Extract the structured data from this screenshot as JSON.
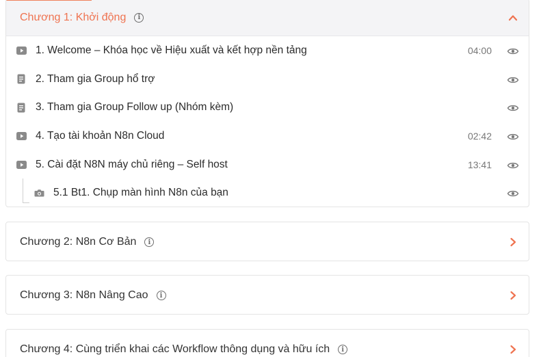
{
  "chapters": [
    {
      "title": "Chương 1: Khởi động",
      "expanded": true,
      "lessons": [
        {
          "icon": "video-icon",
          "title": "1. Welcome – Khóa học về Hiệu xuất và kết hợp nền tảng",
          "duration": "04:00"
        },
        {
          "icon": "document-icon",
          "title": "2. Tham gia Group hổ trợ",
          "duration": ""
        },
        {
          "icon": "document-icon",
          "title": "3. Tham gia Group Follow up (Nhóm kèm)",
          "duration": ""
        },
        {
          "icon": "video-icon",
          "title": "4. Tạo tài khoản N8n Cloud",
          "duration": "02:42"
        },
        {
          "icon": "video-icon",
          "title": "5. Cài đặt N8N máy chủ riêng – Self host",
          "duration": "13:41"
        },
        {
          "icon": "camera-icon",
          "title": "5.1 Bt1. Chụp màn hình N8n của bạn",
          "duration": ""
        }
      ]
    },
    {
      "title": "Chương 2: N8n Cơ Bản",
      "expanded": false
    },
    {
      "title": "Chương 3: N8n Nâng Cao",
      "expanded": false
    },
    {
      "title": "Chương 4: Cùng triển khai các Workflow thông dụng và hữu ích",
      "expanded": false
    }
  ],
  "colors": {
    "accent": "#ef7350",
    "icon_gray": "#8a8a8a"
  }
}
